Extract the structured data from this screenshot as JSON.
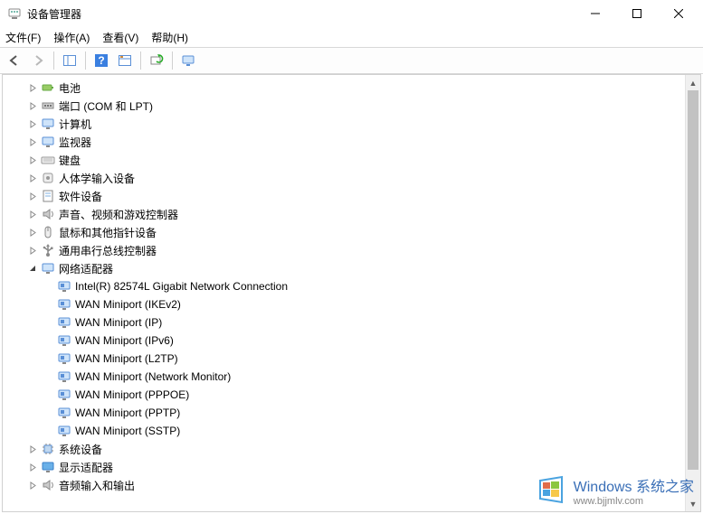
{
  "window": {
    "title": "设备管理器",
    "accent": "#0078d7"
  },
  "menu": {
    "file": "文件(F)",
    "action": "操作(A)",
    "view": "查看(V)",
    "help": "帮助(H)"
  },
  "toolbar": {
    "back": "back",
    "forward": "forward",
    "show_hide": "show-hide-tree",
    "help": "help",
    "props": "properties",
    "scan": "scan-hardware",
    "monitor": "monitor"
  },
  "tree": [
    {
      "id": "battery",
      "label": "电池",
      "icon": "battery",
      "depth": 1,
      "expandable": true,
      "expanded": false
    },
    {
      "id": "ports",
      "label": "端口 (COM 和 LPT)",
      "icon": "port",
      "depth": 1,
      "expandable": true,
      "expanded": false
    },
    {
      "id": "computer",
      "label": "计算机",
      "icon": "monitor",
      "depth": 1,
      "expandable": true,
      "expanded": false
    },
    {
      "id": "monitors",
      "label": "监视器",
      "icon": "monitor",
      "depth": 1,
      "expandable": true,
      "expanded": false
    },
    {
      "id": "keyboards",
      "label": "键盘",
      "icon": "keyboard",
      "depth": 1,
      "expandable": true,
      "expanded": false
    },
    {
      "id": "hid",
      "label": "人体学输入设备",
      "icon": "hid",
      "depth": 1,
      "expandable": true,
      "expanded": false
    },
    {
      "id": "software",
      "label": "软件设备",
      "icon": "software",
      "depth": 1,
      "expandable": true,
      "expanded": false
    },
    {
      "id": "sound",
      "label": "声音、视频和游戏控制器",
      "icon": "speaker",
      "depth": 1,
      "expandable": true,
      "expanded": false
    },
    {
      "id": "mouse",
      "label": "鼠标和其他指针设备",
      "icon": "mouse",
      "depth": 1,
      "expandable": true,
      "expanded": false
    },
    {
      "id": "usb",
      "label": "通用串行总线控制器",
      "icon": "usb",
      "depth": 1,
      "expandable": true,
      "expanded": false
    },
    {
      "id": "network",
      "label": "网络适配器",
      "icon": "monitor",
      "depth": 1,
      "expandable": true,
      "expanded": true,
      "children": [
        {
          "label": "Intel(R) 82574L Gigabit Network Connection",
          "icon": "nic"
        },
        {
          "label": "WAN Miniport (IKEv2)",
          "icon": "nic"
        },
        {
          "label": "WAN Miniport (IP)",
          "icon": "nic"
        },
        {
          "label": "WAN Miniport (IPv6)",
          "icon": "nic"
        },
        {
          "label": "WAN Miniport (L2TP)",
          "icon": "nic"
        },
        {
          "label": "WAN Miniport (Network Monitor)",
          "icon": "nic"
        },
        {
          "label": "WAN Miniport (PPPOE)",
          "icon": "nic"
        },
        {
          "label": "WAN Miniport (PPTP)",
          "icon": "nic"
        },
        {
          "label": "WAN Miniport (SSTP)",
          "icon": "nic"
        }
      ]
    },
    {
      "id": "system",
      "label": "系统设备",
      "icon": "chip",
      "depth": 1,
      "expandable": true,
      "expanded": false
    },
    {
      "id": "display",
      "label": "显示适配器",
      "icon": "display",
      "depth": 1,
      "expandable": true,
      "expanded": false
    },
    {
      "id": "audio",
      "label": "音频输入和输出",
      "icon": "speaker",
      "depth": 1,
      "expandable": true,
      "expanded": false
    }
  ],
  "watermark": {
    "brand": "Windows 系统之家",
    "url": "www.bjjmlv.com"
  }
}
